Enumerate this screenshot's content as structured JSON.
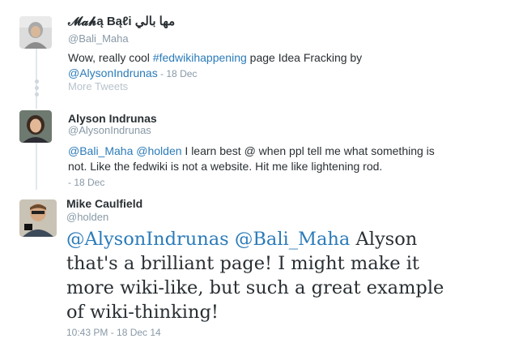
{
  "tweets": [
    {
      "name": "𝓜𝓪𝓱ą Bąℓi مها بالي",
      "handle": "@Bali_Maha",
      "text_before": "Wow, really cool ",
      "hashtag": "#fedwikihappening",
      "text_after": " page Idea Fracking by",
      "mention": "@AlysonIndrunas",
      "time": " - 18 Dec",
      "more": "More Tweets"
    },
    {
      "name": "Alyson Indrunas",
      "handle": "@AlysonIndrunas",
      "mention1": "@Bali_Maha",
      "mention2": "@holden",
      "text": " I learn best @ when ppl tell me what something is not. Like the fedwiki is not a website. Hit me like lightening rod.",
      "time": "- 18 Dec"
    },
    {
      "name": "Mike Caulfield",
      "handle": "@holden",
      "mention1": "@AlysonIndrunas",
      "mention2": "@Bali_Maha",
      "text": " Alyson that's a brilliant page! I might make it more wiki-like, but such a great example of wiki-thinking!",
      "timestamp": "10:43 PM - 18 Dec 14"
    }
  ],
  "colors": {
    "link": "#2b7bb9",
    "meta": "#8899a6",
    "thread": "#e1e8ed"
  }
}
